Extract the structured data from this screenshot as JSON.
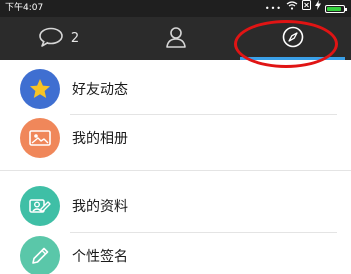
{
  "status_bar": {
    "time": "下午4:07",
    "dots": "•••",
    "battery_level": 0.85,
    "icons": [
      "wifi-icon",
      "sim-icon",
      "charging-icon",
      "battery-icon"
    ]
  },
  "tabs": [
    {
      "icon": "chat-bubble-icon",
      "count": "2",
      "active": false
    },
    {
      "icon": "contacts-icon",
      "active": false
    },
    {
      "icon": "compass-icon",
      "active": true
    }
  ],
  "list": {
    "items": [
      {
        "label": "好友动态",
        "icon": "star-icon",
        "color": "#3f6fd1"
      },
      {
        "label": "我的相册",
        "icon": "photo-icon",
        "color": "#f0875a"
      },
      {
        "label": "我的资料",
        "icon": "profile-card-icon",
        "color": "#3fbfa6"
      },
      {
        "label": "个性签名",
        "icon": "pencil-icon",
        "color": "#5ac7a9"
      }
    ]
  },
  "colors": {
    "tab_bar": "#2b2b2b",
    "active_underline": "#3aa0e8",
    "highlight_ring": "#e01414"
  }
}
